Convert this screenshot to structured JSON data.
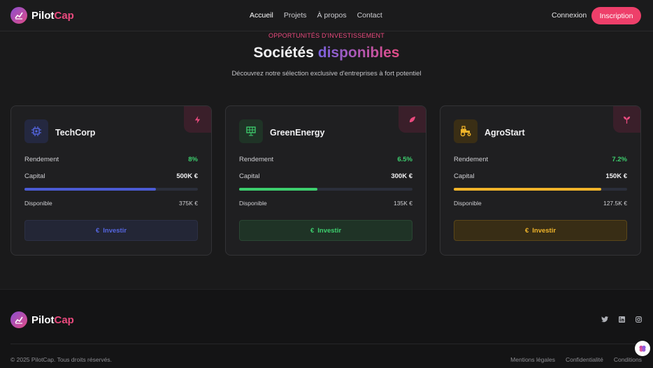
{
  "brand": {
    "name_part1": "Pilot",
    "name_part2": "Cap",
    "gradient_start": "#8b4fd0",
    "gradient_end": "#e04c86"
  },
  "nav": {
    "links": [
      {
        "label": "Accueil",
        "active": true
      },
      {
        "label": "Projets"
      },
      {
        "label": "À propos"
      },
      {
        "label": "Contact"
      }
    ],
    "login_label": "Connexion",
    "signup_label": "Inscription"
  },
  "header": {
    "eyebrow": "OPPORTUNITÉS D'INVESTISSEMENT",
    "title_plain": "Sociétés",
    "title_highlight": "disponibles",
    "subtitle": "Découvrez notre sélection exclusive d'entreprises à fort potentiel"
  },
  "cards": [
    {
      "name": "TechCorp",
      "icon": "chip-icon",
      "corner_icon": "lightning-icon",
      "accent": "#4b5bd4",
      "rendement_label": "Rendement",
      "rendement": "8%",
      "capital_label": "Capital",
      "capital": "500K €",
      "progress": 0.76,
      "disponible_label": "Disponible",
      "disponible": "375K €",
      "button_icon": "€",
      "button_label": "Investir"
    },
    {
      "name": "GreenEnergy",
      "icon": "solar-panel-icon",
      "corner_icon": "leaf-icon",
      "accent": "#3dcf6e",
      "rendement_label": "Rendement",
      "rendement": "6.5%",
      "capital_label": "Capital",
      "capital": "300K €",
      "progress": 0.45,
      "disponible_label": "Disponible",
      "disponible": "135K €",
      "button_icon": "€",
      "button_label": "Investir"
    },
    {
      "name": "AgroStart",
      "icon": "tractor-icon",
      "corner_icon": "seedling-icon",
      "accent": "#f0b42a",
      "rendement_label": "Rendement",
      "rendement": "7.2%",
      "capital_label": "Capital",
      "capital": "150K €",
      "progress": 0.85,
      "disponible_label": "Disponible",
      "disponible": "127.5K €",
      "button_icon": "€",
      "button_label": "Investir"
    }
  ],
  "footer": {
    "copyright": "© 2025 PilotCap. Tous droits réservés.",
    "links": [
      "Mentions légales",
      "Confidentialité",
      "Conditions"
    ],
    "socials": [
      "twitter-icon",
      "linkedin-icon",
      "instagram-icon"
    ]
  },
  "colors": {
    "pink": "#ee3f6a",
    "value_green": "#3dcf6e",
    "background": "#1a1a1b"
  }
}
